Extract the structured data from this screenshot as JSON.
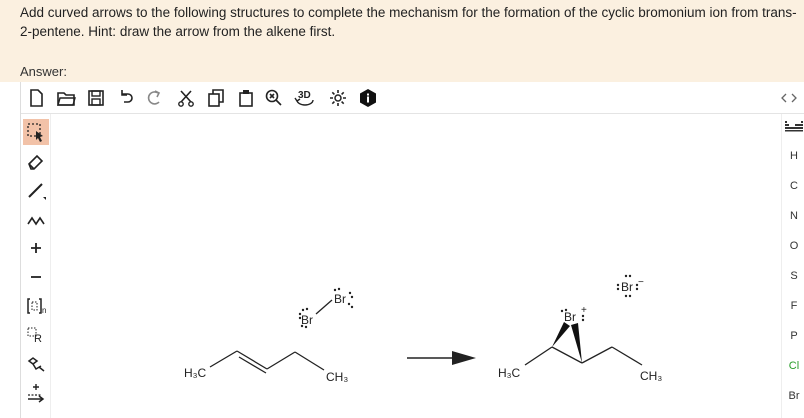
{
  "question": {
    "text": "Add curved arrows to the following structures to complete the mechanism for the formation of the cyclic bromonium ion from trans-2-pentene. Hint: draw the arrow from the alkene first.",
    "answer_label": "Answer:"
  },
  "toolbar": {
    "threed_label": "3D"
  },
  "right_panel": {
    "elements": [
      "H",
      "C",
      "N",
      "O",
      "S",
      "F",
      "P",
      "Cl",
      "Br"
    ],
    "element_colors": {
      "Cl": "#2a9d2a"
    }
  },
  "left_panel": {
    "bracket_label": "n",
    "rgroup_label": "R"
  },
  "molecules": {
    "reactant_h3c": "H₃C",
    "reactant_ch3": "CH₃",
    "br2_top": "Br",
    "br2_bottom": "Br",
    "product_h3c": "H₃C",
    "product_ch3": "CH₃",
    "bromonium_br": "Br",
    "bromonium_charge": "+",
    "bromide_br": "Br",
    "bromide_charge": "−"
  }
}
